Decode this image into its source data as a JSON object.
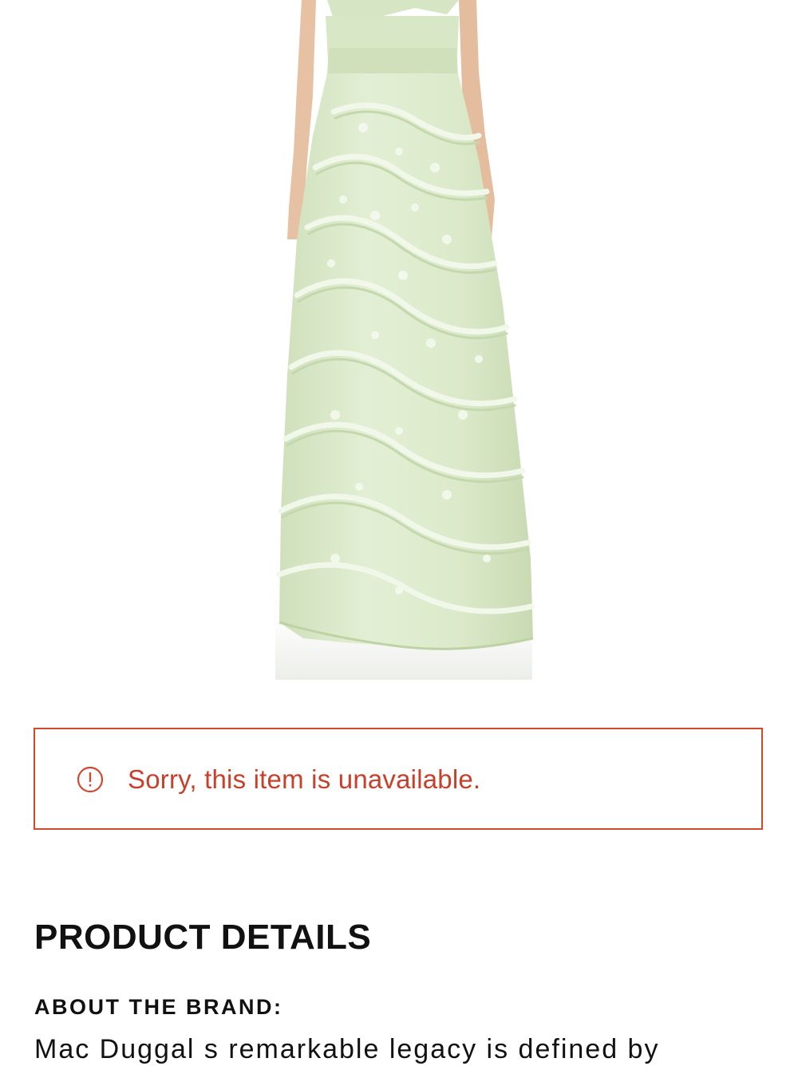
{
  "product_image": {
    "subject": "light green ruffled tulle gown",
    "colors": {
      "dress": "#dfecd0",
      "dress_shadow": "#c6d9b1",
      "ruffle": "#eef6e4",
      "skin": "#e8c4a6",
      "floor": "#f3f4f1"
    }
  },
  "alert": {
    "icon": "alert-circle-icon",
    "message": "Sorry, this item is unavailable.",
    "color": "#d24a2c"
  },
  "details": {
    "title": "PRODUCT DETAILS",
    "brand_label": "ABOUT THE BRAND:",
    "brand_text": "Mac Duggal s remarkable legacy is defined by"
  }
}
